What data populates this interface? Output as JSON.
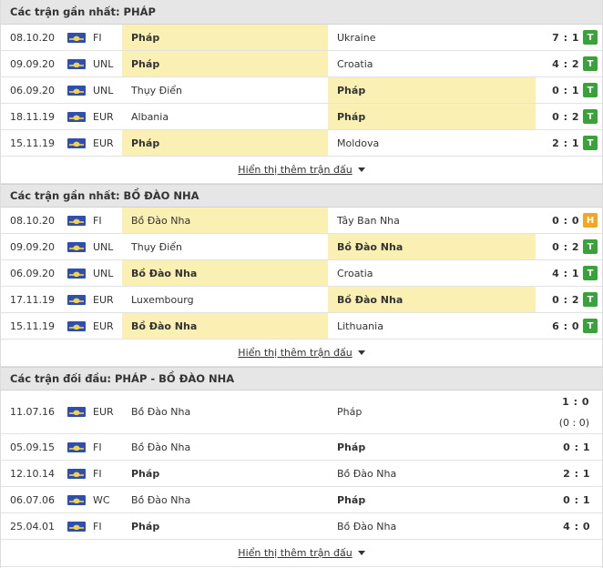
{
  "sections": [
    {
      "title": "Các trận gần nhất: PHÁP",
      "more_label": "Hiển thị thêm trận đấu",
      "rows": [
        {
          "date": "08.10.20",
          "comp": "FI",
          "home": "Pháp",
          "away": "Ukraine",
          "score": "7 : 1",
          "result": "T",
          "hl": "home"
        },
        {
          "date": "09.09.20",
          "comp": "UNL",
          "home": "Pháp",
          "away": "Croatia",
          "score": "4 : 2",
          "result": "T",
          "hl": "home"
        },
        {
          "date": "06.09.20",
          "comp": "UNL",
          "home": "Thụy Điển",
          "away": "Pháp",
          "score": "0 : 1",
          "result": "T",
          "hl": "away"
        },
        {
          "date": "18.11.19",
          "comp": "EUR",
          "home": "Albania",
          "away": "Pháp",
          "score": "0 : 2",
          "result": "T",
          "hl": "away"
        },
        {
          "date": "15.11.19",
          "comp": "EUR",
          "home": "Pháp",
          "away": "Moldova",
          "score": "2 : 1",
          "result": "T",
          "hl": "home"
        }
      ]
    },
    {
      "title": "Các trận gần nhất: BỒ ĐÀO NHA",
      "more_label": "Hiển thị thêm trận đấu",
      "rows": [
        {
          "date": "08.10.20",
          "comp": "FI",
          "home": "Bồ Đào Nha",
          "away": "Tây Ban Nha",
          "score": "0 : 0",
          "result": "H",
          "hl": "home",
          "home_bold": false
        },
        {
          "date": "09.09.20",
          "comp": "UNL",
          "home": "Thụy Điển",
          "away": "Bồ Đào Nha",
          "score": "0 : 2",
          "result": "T",
          "hl": "away"
        },
        {
          "date": "06.09.20",
          "comp": "UNL",
          "home": "Bồ Đào Nha",
          "away": "Croatia",
          "score": "4 : 1",
          "result": "T",
          "hl": "home"
        },
        {
          "date": "17.11.19",
          "comp": "EUR",
          "home": "Luxembourg",
          "away": "Bồ Đào Nha",
          "score": "0 : 2",
          "result": "T",
          "hl": "away"
        },
        {
          "date": "15.11.19",
          "comp": "EUR",
          "home": "Bồ Đào Nha",
          "away": "Lithuania",
          "score": "6 : 0",
          "result": "T",
          "hl": "home"
        }
      ]
    },
    {
      "title": "Các trận đối đầu: PHÁP - BỒ ĐÀO NHA",
      "more_label": "Hiển thị thêm trận đấu",
      "rows": [
        {
          "date": "11.07.16",
          "comp": "EUR",
          "home": "Bồ Đào Nha",
          "away": "Pháp",
          "score": "1 : 0",
          "sub_score": "(0 : 0)",
          "win": "none"
        },
        {
          "date": "05.09.15",
          "comp": "FI",
          "home": "Bồ Đào Nha",
          "away": "Pháp",
          "score": "0 : 1",
          "win": "away"
        },
        {
          "date": "12.10.14",
          "comp": "FI",
          "home": "Pháp",
          "away": "Bồ Đào Nha",
          "score": "2 : 1",
          "win": "home"
        },
        {
          "date": "06.07.06",
          "comp": "WC",
          "home": "Bồ Đào Nha",
          "away": "Pháp",
          "score": "0 : 1",
          "win": "away"
        },
        {
          "date": "25.04.01",
          "comp": "FI",
          "home": "Pháp",
          "away": "Bồ Đào Nha",
          "score": "4 : 0",
          "win": "home"
        }
      ]
    }
  ],
  "colors": {
    "highlight": "#fbf0b4",
    "win_badge": "#3aa23a",
    "draw_badge": "#f2a623",
    "header_bg": "#e6e6e6"
  },
  "icons": {
    "competition": "world-flag-icon",
    "more": "caret-down-icon"
  }
}
